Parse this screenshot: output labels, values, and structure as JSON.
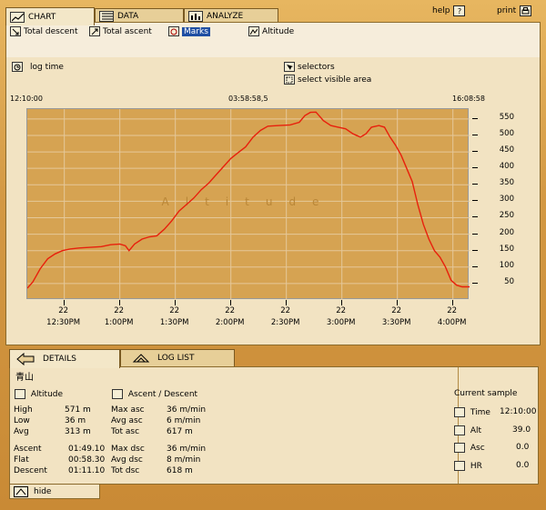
{
  "tabs": [
    {
      "label": "CHART",
      "icon": "chart-icon"
    },
    {
      "label": "DATA",
      "icon": "table-icon"
    },
    {
      "label": "ANALYZE",
      "icon": "analyze-icon"
    }
  ],
  "toolbar": {
    "help": "help",
    "print": "print"
  },
  "options": {
    "total_descent": "Total descent",
    "total_ascent": "Total ascent",
    "marks": "Marks",
    "altitude": "Altitude",
    "log_time": "log time",
    "selectors": "selectors",
    "select_visible_area": "select visible area"
  },
  "time_labels": {
    "start": "12:10:00",
    "mid": "03:58:58,5",
    "end": "16:08:58"
  },
  "chart_data": {
    "type": "line",
    "title": "",
    "watermark": "Altitude",
    "xlabel": "",
    "ylabel": "",
    "x_ticks": [
      {
        "day": "22",
        "time": "12:30PM"
      },
      {
        "day": "22",
        "time": "1:00PM"
      },
      {
        "day": "22",
        "time": "1:30PM"
      },
      {
        "day": "22",
        "time": "2:00PM"
      },
      {
        "day": "22",
        "time": "2:30PM"
      },
      {
        "day": "22",
        "time": "3:00PM"
      },
      {
        "day": "22",
        "time": "3:30PM"
      },
      {
        "day": "22",
        "time": "4:00PM"
      }
    ],
    "y_ticks": [
      50,
      100,
      150,
      200,
      250,
      300,
      350,
      400,
      450,
      500,
      550
    ],
    "ylim": [
      0,
      580
    ],
    "xlim_minutes": [
      0,
      239
    ],
    "series": [
      {
        "color": "#e8200c",
        "points": [
          [
            0,
            36
          ],
          [
            3,
            55
          ],
          [
            7,
            95
          ],
          [
            11,
            125
          ],
          [
            15,
            140
          ],
          [
            19,
            150
          ],
          [
            23,
            155
          ],
          [
            28,
            158
          ],
          [
            34,
            160
          ],
          [
            40,
            162
          ],
          [
            45,
            168
          ],
          [
            50,
            170
          ],
          [
            53,
            165
          ],
          [
            55,
            150
          ],
          [
            58,
            170
          ],
          [
            62,
            185
          ],
          [
            66,
            192
          ],
          [
            70,
            195
          ],
          [
            74,
            215
          ],
          [
            78,
            240
          ],
          [
            82,
            270
          ],
          [
            86,
            290
          ],
          [
            90,
            310
          ],
          [
            94,
            335
          ],
          [
            98,
            355
          ],
          [
            102,
            380
          ],
          [
            106,
            405
          ],
          [
            110,
            430
          ],
          [
            114,
            448
          ],
          [
            118,
            465
          ],
          [
            122,
            495
          ],
          [
            126,
            515
          ],
          [
            130,
            528
          ],
          [
            136,
            530
          ],
          [
            142,
            532
          ],
          [
            147,
            540
          ],
          [
            150,
            560
          ],
          [
            153,
            570
          ],
          [
            156,
            571
          ],
          [
            160,
            545
          ],
          [
            164,
            530
          ],
          [
            168,
            525
          ],
          [
            172,
            520
          ],
          [
            176,
            505
          ],
          [
            180,
            495
          ],
          [
            183,
            505
          ],
          [
            186,
            525
          ],
          [
            190,
            530
          ],
          [
            193,
            525
          ],
          [
            196,
            495
          ],
          [
            199,
            470
          ],
          [
            202,
            440
          ],
          [
            205,
            400
          ],
          [
            208,
            360
          ],
          [
            211,
            290
          ],
          [
            214,
            230
          ],
          [
            217,
            185
          ],
          [
            220,
            150
          ],
          [
            223,
            130
          ],
          [
            226,
            100
          ],
          [
            229,
            60
          ],
          [
            232,
            45
          ],
          [
            235,
            40
          ],
          [
            239,
            40
          ]
        ]
      }
    ]
  },
  "bottom_tabs": {
    "details": "DETAILS",
    "log_list": "LOG LIST"
  },
  "details": {
    "name": "青山",
    "altitude_header": "Altitude",
    "ascent_header": "Ascent / Descent",
    "high_label": "High",
    "high_value": "571 m",
    "low_label": "Low",
    "low_value": "36 m",
    "avg_label": "Avg",
    "avg_value": "313 m",
    "ascent_label": "Ascent",
    "ascent_value": "01:49.10",
    "flat_label": "Flat",
    "flat_value": "00:58.30",
    "descent_label": "Descent",
    "descent_value": "01:11.10",
    "max_asc_label": "Max asc",
    "max_asc_value": "36 m/min",
    "avg_asc_label": "Avg asc",
    "avg_asc_value": "6 m/min",
    "tot_asc_label": "Tot asc",
    "tot_asc_value": "617 m",
    "max_dsc_label": "Max dsc",
    "max_dsc_value": "36 m/min",
    "avg_dsc_label": "Avg dsc",
    "avg_dsc_value": "8 m/min",
    "tot_dsc_label": "Tot dsc",
    "tot_dsc_value": "618 m"
  },
  "current_sample": {
    "title": "Current sample",
    "time_label": "Time",
    "time_value": "12:10:00",
    "alt_label": "Alt",
    "alt_value": "39.0",
    "asc_label": "Asc",
    "asc_value": "0.0",
    "hr_label": "HR",
    "hr_value": "0.0"
  },
  "hide_label": "hide",
  "colors": {
    "line": "#e8200c",
    "plot_bg": "#d6a352",
    "accent": "#1f4fa3"
  }
}
